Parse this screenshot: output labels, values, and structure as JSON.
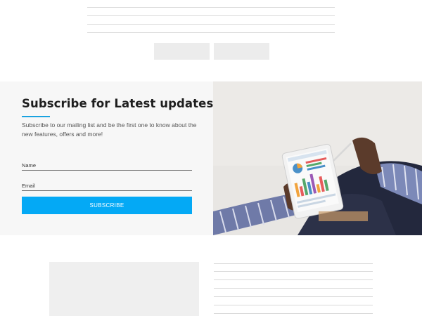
{
  "subscribe": {
    "title": "Subscribe for Latest updates",
    "description": "Subscribe to our mailing list and be the first one to know about the new features, offers and more!",
    "name_placeholder": "Name",
    "email_placeholder": "Email",
    "button_label": "SUBSCRIBE"
  },
  "colors": {
    "accent": "#04a9f5",
    "underline": "#1aa3e0",
    "panel_bg": "#f7f7f7",
    "skeleton": "#ececec"
  },
  "icons": {
    "hero_image": "person-holding-tablet-with-charts"
  }
}
